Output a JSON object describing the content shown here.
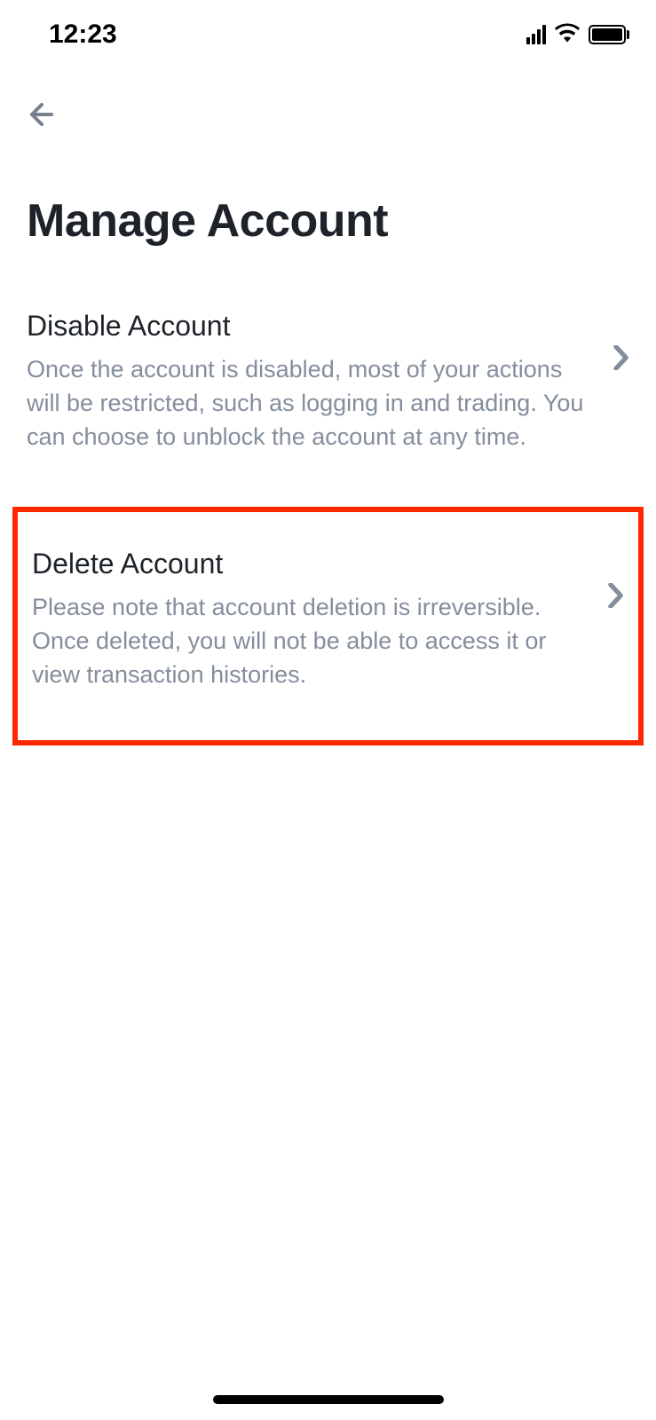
{
  "statusBar": {
    "time": "12:23"
  },
  "pageTitle": "Manage Account",
  "options": [
    {
      "title": "Disable Account",
      "description": "Once the account is disabled, most of your actions will be restricted, such as logging in and trading. You can choose to unblock the account at any time."
    },
    {
      "title": "Delete Account",
      "description": "Please note that account deletion is irreversible. Once deleted, you will not be able to access it or view transaction histories."
    }
  ]
}
